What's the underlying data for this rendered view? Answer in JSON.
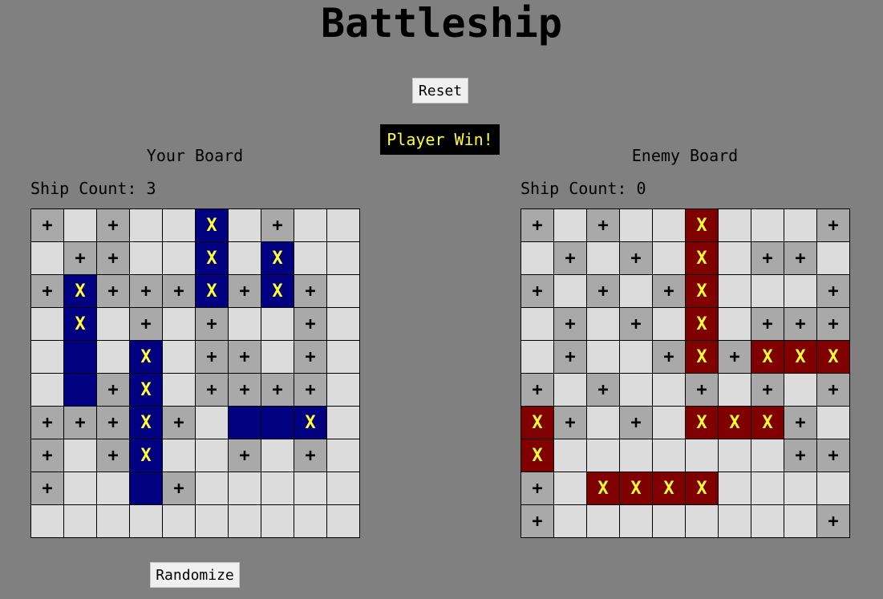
{
  "app_title": "Battleship",
  "reset_label": "Reset",
  "status_text": "Player Win!",
  "randomize_label": "Randomize",
  "player_board": {
    "title": "Your Board",
    "ship_count": "Ship Count: 3",
    "legend": {
      ".": "empty",
      "+": "miss",
      "S": "ship",
      "X": "hit"
    },
    "rows": [
      "+.+..X.+..",
      ".++..X.X..",
      "+X+++X+X+.",
      ".X.+.+..+.",
      ".S.X.++.+.",
      ".S+X.++++.",
      "+++X+.SSX.",
      "+.+X..+.+.",
      "+..S+.....",
      ".........."
    ]
  },
  "enemy_board": {
    "title": "Enemy Board",
    "ship_count": "Ship Count: 0",
    "legend": {
      ".": "empty",
      "+": "miss",
      "X": "hit"
    },
    "rows": [
      "+.+..X...+",
      ".+.+.X.++.",
      "+.+.+X...+",
      ".+.+.X.+++",
      ".+..+X+XXX",
      "+.+..+.+.+",
      "X+.+.XXX+.",
      "X.......++",
      "+.XXXX....",
      "+........+"
    ]
  },
  "colors": {
    "background": "#808080",
    "empty": "#dcdcdc",
    "miss": "#a9a9a9",
    "player_ship": "#000080",
    "enemy_hit": "#800000",
    "hit_mark": "#ffff33"
  },
  "marks": {
    "miss": "+",
    "hit": "X"
  }
}
